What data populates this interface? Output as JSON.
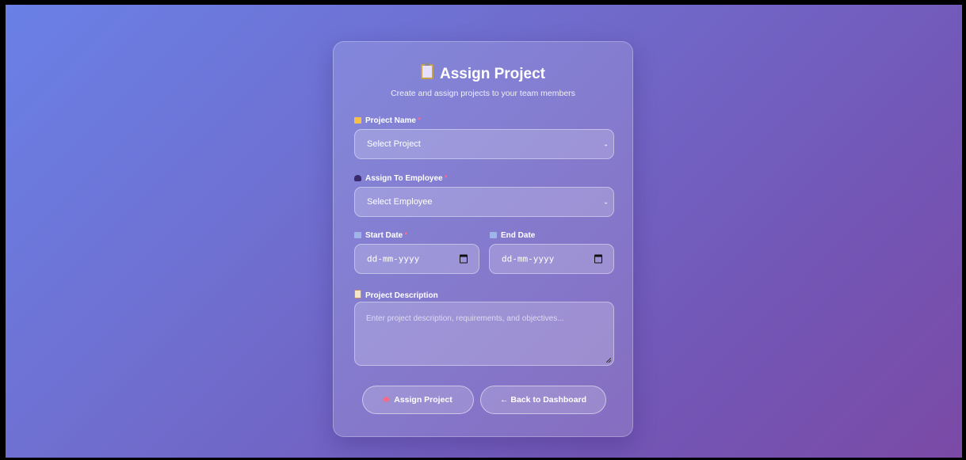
{
  "form": {
    "title": "Assign Project",
    "subtitle": "Create and assign projects to your team members",
    "project_name": {
      "label": "Project Name",
      "required_mark": "*",
      "selected": "Select Project"
    },
    "employee": {
      "label": "Assign To Employee",
      "required_mark": "*",
      "selected": "Select Employee"
    },
    "start_date": {
      "label": "Start Date",
      "required_mark": "*",
      "value": "dd-mm-yyyy"
    },
    "end_date": {
      "label": "End Date",
      "value": "dd-mm-yyyy"
    },
    "description": {
      "label": "Project Description",
      "placeholder": "Enter project description, requirements, and objectives..."
    },
    "submit_label": "Assign Project",
    "back_label": "← Back to Dashboard"
  },
  "icons": {
    "title": "clipboard-icon",
    "project_name": "folder-icon",
    "employee": "person-icon",
    "start_date": "calendar-icon",
    "end_date": "calendar-icon",
    "description": "memo-icon",
    "submit": "rocket-icon"
  },
  "colors": {
    "gradient_start": "#6a80e6",
    "gradient_end": "#7b4aa6",
    "required": "#ff6b8a"
  }
}
